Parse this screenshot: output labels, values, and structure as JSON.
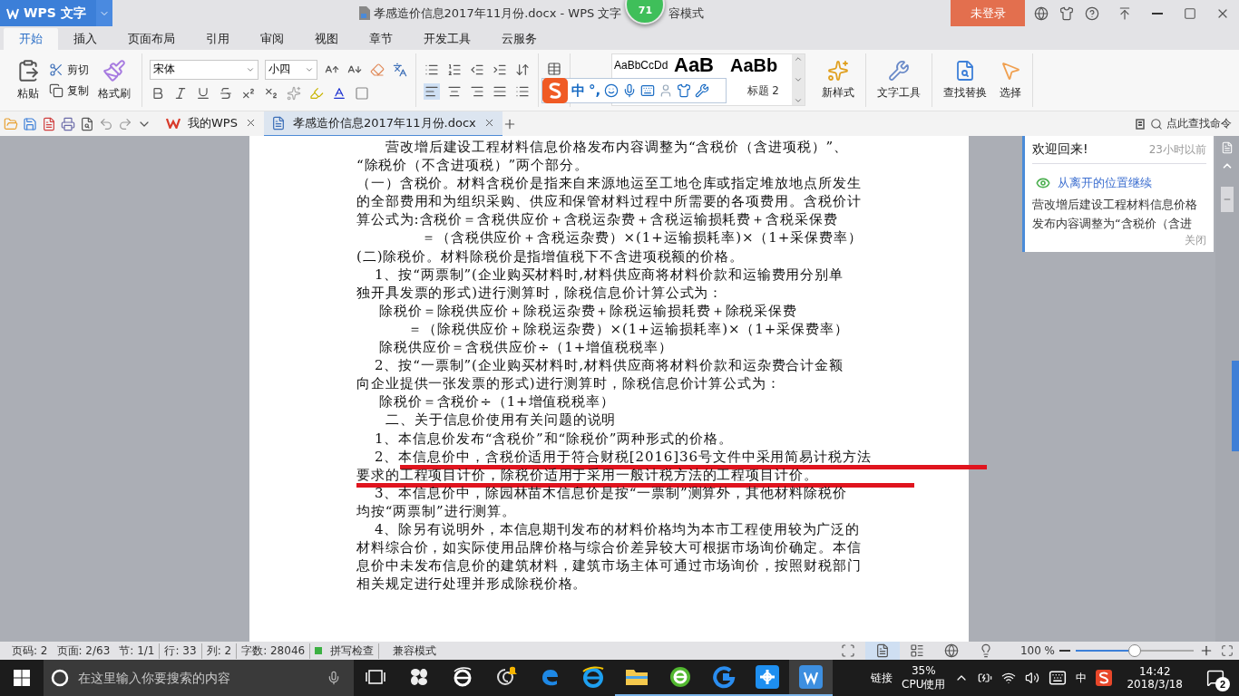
{
  "app_button": {
    "label": "WPS 文字"
  },
  "window": {
    "title": "孝感造价信息2017年11月份.docx - WPS 文字",
    "title_rest": "容模式"
  },
  "floating_badge": {
    "label": "71"
  },
  "account": {
    "label": "未登录"
  },
  "ribbon_tabs": [
    {
      "label": "开始",
      "selected": true
    },
    {
      "label": "插入",
      "selected": false
    },
    {
      "label": "页面布局",
      "selected": false
    },
    {
      "label": "引用",
      "selected": false
    },
    {
      "label": "审阅",
      "selected": false
    },
    {
      "label": "视图",
      "selected": false
    },
    {
      "label": "章节",
      "selected": false
    },
    {
      "label": "开发工具",
      "selected": false
    },
    {
      "label": "云服务",
      "selected": false
    }
  ],
  "ribbon": {
    "paste": "粘贴",
    "cut": "剪切",
    "copy": "复制",
    "format_painter": "格式刷",
    "font": "宋体",
    "font_size": "小四",
    "styles": [
      {
        "label": "AaBbCcDd",
        "kind": "normal"
      },
      {
        "label": "AaB",
        "kind": "heading1"
      },
      {
        "label": "AaBb",
        "kind": "heading2"
      }
    ],
    "style_name": "标题 2",
    "new_style": "新样式",
    "text_tools": "文字工具",
    "find_replace": "查找替换",
    "select": "选择"
  },
  "ime_bar": {
    "language": "中",
    "punctuation": "°,"
  },
  "doc_tabs": [
    {
      "label": "我的WPS",
      "selected": false
    },
    {
      "label": "孝感造价信息2017年11月份.docx",
      "selected": true
    }
  ],
  "command_search": "点此查找命令",
  "document": {
    "lines": [
      {
        "text": "营改增后建设工程材料信息价格发布内容调整为“含税价（含进项税）”、",
        "kind": "heading",
        "underlined": false
      },
      {
        "text": "“除税价（不含进项税）”两个部分。",
        "kind": "flush",
        "underlined": false
      },
      {
        "text": "（一）含税价。材料含税价是指来自来源地运至工地仓库或指定堆放地点所发生",
        "kind": "flush",
        "underlined": false
      },
      {
        "text": "的全部费用和为组织采购、供应和保管材料过程中所需要的各项费用。含税价计",
        "kind": "flush",
        "underlined": false
      },
      {
        "text": "算公式为:含税价＝含税供应价＋含税运杂费＋含税运输损耗费＋含税采保费",
        "kind": "flush",
        "underlined": false
      },
      {
        "text": "＝（含税供应价＋含税运杂费）×(1+运输损耗率)×（1+采保费率）",
        "kind": "deep",
        "underlined": false
      },
      {
        "text": "(二)除税价。材料除税价是指增值税下不含进项税额的价格。",
        "kind": "flush",
        "underlined": false
      },
      {
        "text": "1、按“两票制”(企业购买材料时,材料供应商将材料价款和运输费用分别单",
        "kind": "item",
        "underlined": false
      },
      {
        "text": "独开具发票的形式)进行测算时，除税信息价计算公式为：",
        "kind": "flush",
        "underlined": false
      },
      {
        "text": "除税价＝除税供应价＋除税运杂费＋除税运输损耗费＋除税采保费",
        "kind": "formula",
        "underlined": false
      },
      {
        "text": "＝（除税供应价＋除税运杂费）×(1+运输损耗率)×（1+采保费率）",
        "kind": "continued",
        "underlined": false
      },
      {
        "text": "除税供应价＝含税供应价÷（1+增值税税率）",
        "kind": "formula",
        "underlined": false
      },
      {
        "text": "2、按“一票制”(企业购买材料时,材料供应商将材料价款和运杂费合计金额",
        "kind": "item",
        "underlined": false
      },
      {
        "text": "向企业提供一张发票的形式)进行测算时，除税信息价计算公式为：",
        "kind": "flush",
        "underlined": false
      },
      {
        "text": "除税价＝含税价÷（1+增值税税率）",
        "kind": "formula",
        "underlined": false
      },
      {
        "text": "二、关于信息价使用有关问题的说明",
        "kind": "heading",
        "underlined": false
      },
      {
        "text": "1、本信息价发布“含税价”和“除税价”两种形式的价格。",
        "kind": "item",
        "underlined": false
      },
      {
        "text": "2、本信息价中，含税价适用于符合财税[2016]36号文件中采用简易计税方法",
        "kind": "item",
        "underlined": true
      },
      {
        "text": "要求的工程项目计价，除税价适用于采用一般计税方法的工程项目计价。",
        "kind": "flush",
        "underlined": true
      },
      {
        "text": "3、本信息价中，除园林苗木信息价是按“一票制”测算外，其他材料除税价",
        "kind": "item",
        "underlined": false
      },
      {
        "text": "均按“两票制”进行测算。",
        "kind": "flush",
        "underlined": false
      },
      {
        "text": "4、除另有说明外，本信息期刊发布的材料价格均为本市工程使用较为广泛的",
        "kind": "item",
        "underlined": false
      },
      {
        "text": "材料综合价，如实际使用品牌价格与综合价差异较大可根据市场询价确定。本信",
        "kind": "flush",
        "underlined": false
      },
      {
        "text": "息价中未发布信息价的建筑材料，建筑市场主体可通过市场询价，按照财税部门",
        "kind": "flush",
        "underlined": false
      },
      {
        "text": "相关规定进行处理并形成除税价格。",
        "kind": "flush",
        "underlined": false
      }
    ]
  },
  "notice": {
    "title": "欢迎回来!",
    "time": "23小时以前",
    "link": "从离开的位置继续",
    "body": [
      "营改增后建设工程材料信息价格",
      "发布内容调整为“含税价（含进"
    ],
    "close": "关闭"
  },
  "status_bar": {
    "items": [
      "页码: 2",
      "页面: 2/63",
      "节: 1/1",
      "行: 33",
      "列: 2",
      "字数: 28046"
    ],
    "spell_check": "拼写检查",
    "mode": "兼容模式",
    "zoom": "100 %",
    "view_buttons": [
      {
        "kind": "fullscreen",
        "selected": false
      },
      {
        "kind": "page",
        "selected": true
      },
      {
        "kind": "outline",
        "selected": false
      },
      {
        "kind": "web",
        "selected": false
      },
      {
        "kind": "reading",
        "selected": false
      }
    ],
    "zoom_slider": {
      "level": 0.5
    }
  },
  "taskbar": {
    "search_placeholder": "在这里输入你要搜索的内容",
    "apps": [
      {
        "kind": "task_view",
        "running": false,
        "selected": false
      },
      {
        "kind": "pinwheel",
        "running": false,
        "selected": false
      },
      {
        "kind": "ie_white",
        "running": false,
        "selected": false
      },
      {
        "kind": "swirl",
        "running": false,
        "selected": false
      },
      {
        "kind": "edge",
        "running": false,
        "selected": false
      },
      {
        "kind": "ie_blue",
        "running": false,
        "selected": false
      },
      {
        "kind": "folder",
        "running": true,
        "selected": false
      },
      {
        "kind": "green_browser",
        "running": true,
        "selected": false
      },
      {
        "kind": "g_app",
        "running": true,
        "selected": false
      },
      {
        "kind": "plus_app",
        "running": true,
        "selected": false
      },
      {
        "kind": "wps",
        "running": true,
        "selected": true
      }
    ],
    "links": "链接",
    "cpu_value": "35%",
    "cpu_label": "CPU使用",
    "ime": "中",
    "time": "14:42",
    "date": "2018/3/18",
    "notifications": "2"
  }
}
